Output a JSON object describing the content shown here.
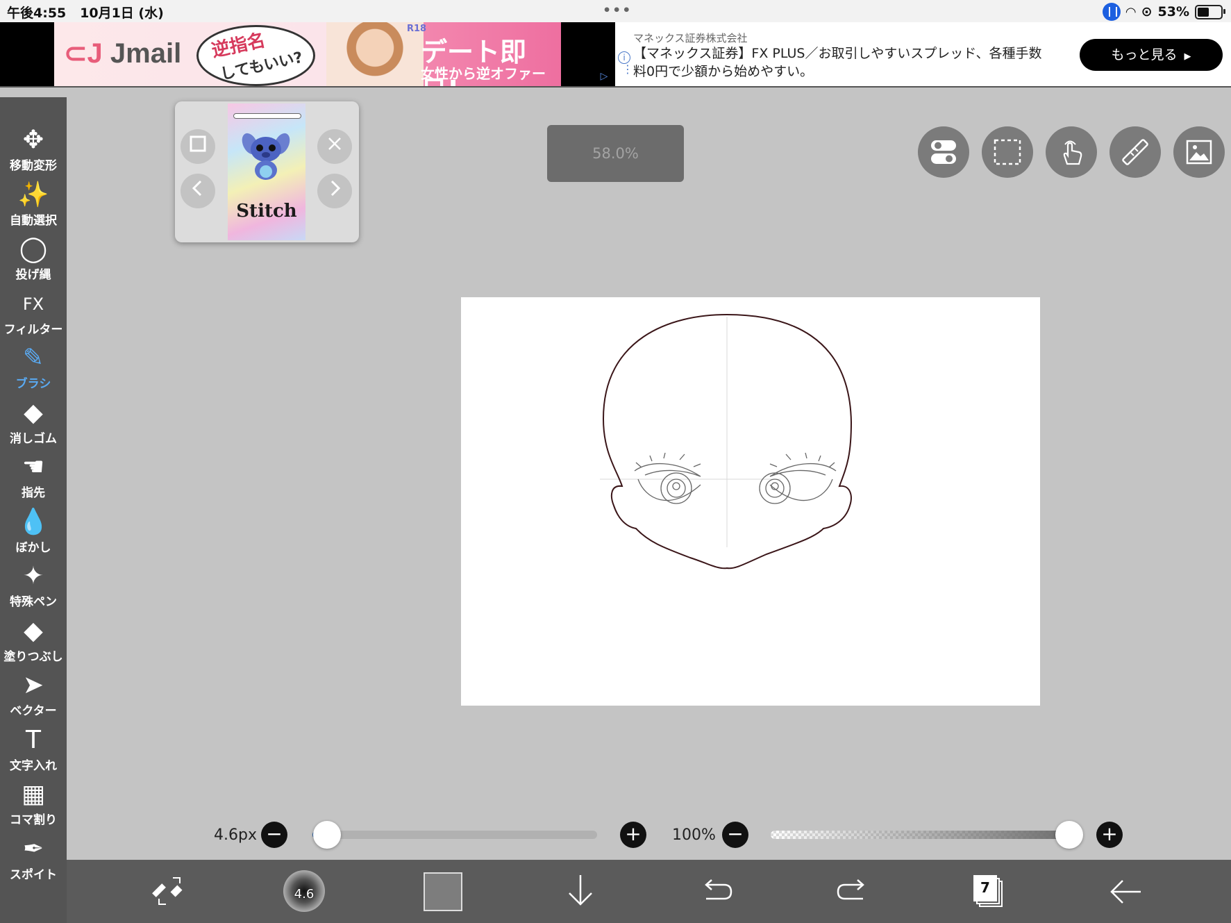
{
  "status_bar": {
    "time": "午後4:55",
    "date": "10月1日 (水)",
    "battery": "53%",
    "battery_level": 0.53
  },
  "ad": {
    "brand": "Jmail",
    "bubble_line1": "逆指名",
    "bubble_line2": "してもいい?",
    "rating": "R18",
    "headline": "デート即日!",
    "subline": "女性から逆オファー",
    "sponsor": "マネックス証券株式会社",
    "copy": "【マネックス証券】FX PLUS／お取引しやすいスプレッド、各種手数料0円で少額から始めやすい。",
    "cta": "もっと見る"
  },
  "tools": [
    {
      "icon": "move-transform-icon",
      "glyph": "✥",
      "label": "移動変形",
      "active": false
    },
    {
      "icon": "magic-wand-icon",
      "glyph": "✨",
      "label": "自動選択",
      "active": false
    },
    {
      "icon": "lasso-icon",
      "glyph": "◯",
      "label": "投げ縄",
      "active": false
    },
    {
      "icon": "fx-filter-icon",
      "glyph": "FX",
      "label": "フィルター",
      "active": false
    },
    {
      "icon": "brush-icon",
      "glyph": "✎",
      "label": "ブラシ",
      "active": true
    },
    {
      "icon": "eraser-icon",
      "glyph": "◆",
      "label": "消しゴム",
      "active": false
    },
    {
      "icon": "finger-smudge-icon",
      "glyph": "☚",
      "label": "指先",
      "active": false
    },
    {
      "icon": "blur-drop-icon",
      "glyph": "💧",
      "label": "ぼかし",
      "active": false
    },
    {
      "icon": "special-pen-icon",
      "glyph": "✦",
      "label": "特殊ペン",
      "active": false
    },
    {
      "icon": "fill-bucket-icon",
      "glyph": "◆",
      "label": "塗りつぶし",
      "active": false
    },
    {
      "icon": "vector-cursor-icon",
      "glyph": "➤",
      "label": "ベクター",
      "active": false
    },
    {
      "icon": "text-icon",
      "glyph": "T",
      "label": "文字入れ",
      "active": false
    },
    {
      "icon": "frame-divide-icon",
      "glyph": "▦",
      "label": "コマ割り",
      "active": false
    },
    {
      "icon": "eyedropper-icon",
      "glyph": "✒",
      "label": "スポイト",
      "active": false
    }
  ],
  "reference": {
    "title": "Stitch"
  },
  "zoom": "58.0%",
  "brush": {
    "size_label": "4.6px",
    "size_value": 4.6,
    "size_fraction": 0.05,
    "opacity_label": "100%",
    "opacity_fraction": 1.0,
    "preview_value": "4.6"
  },
  "layers": {
    "count": "7"
  },
  "colors": {
    "active_tool": "#5aaaf2",
    "current_color": "#7d7d7d",
    "sketch_line": "#3a1518"
  }
}
